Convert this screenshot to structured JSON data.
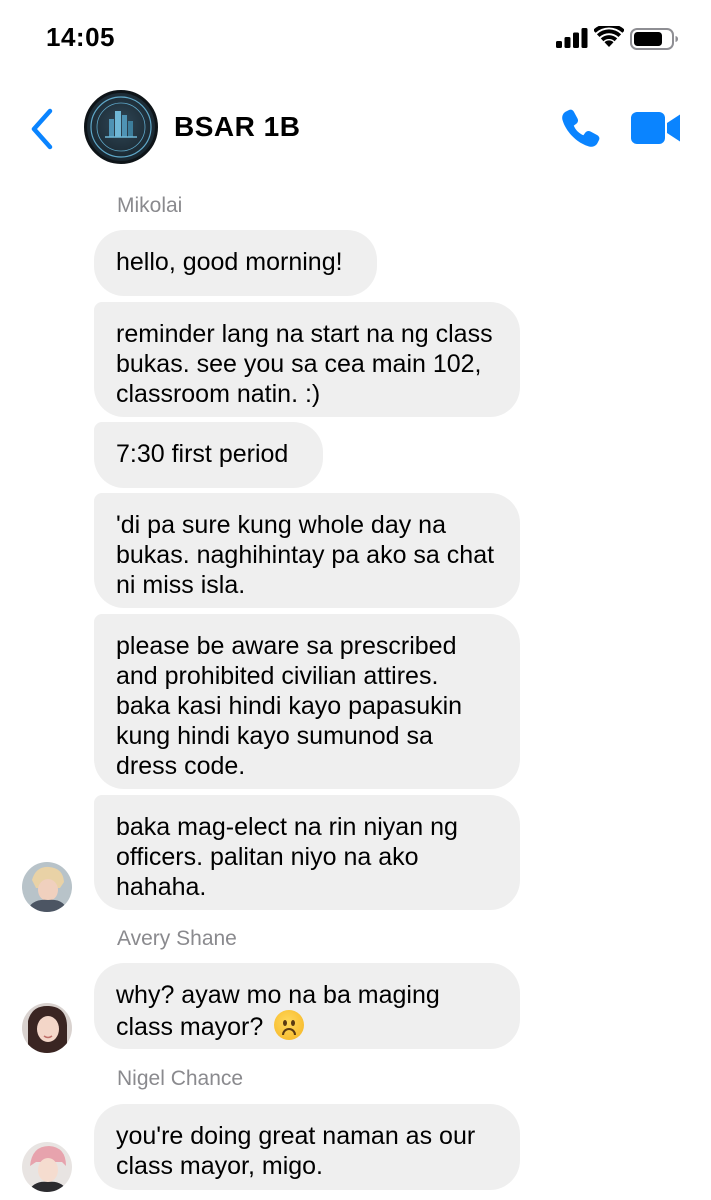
{
  "status_bar": {
    "time": "14:05"
  },
  "header": {
    "title": "BSAR 1B"
  },
  "messages": {
    "sender_1": "Mikolai",
    "m1": "hello, good morning!",
    "m2": "reminder lang na start na ng class bukas. see you sa cea main 102, classroom natin. :)",
    "m3": "7:30 first period",
    "m4": "'di pa sure kung whole day na bukas. naghihintay pa ako sa chat ni miss isla.",
    "m5": "please be aware sa prescribed and prohibited civilian attires. baka kasi hindi kayo papasukin kung hindi kayo sumunod sa dress code.",
    "m6": "baka mag-elect na rin niyan ng officers. palitan niyo na ako hahaha.",
    "sender_2": "Avery Shane",
    "m7": "why? ayaw mo na ba maging class mayor?",
    "sender_3": "Nigel Chance",
    "m8": "you're doing great naman as our class mayor, migo."
  },
  "colors": {
    "accent": "#0a84ff",
    "bubble": "#efefef",
    "sender": "#8a8a8e"
  }
}
